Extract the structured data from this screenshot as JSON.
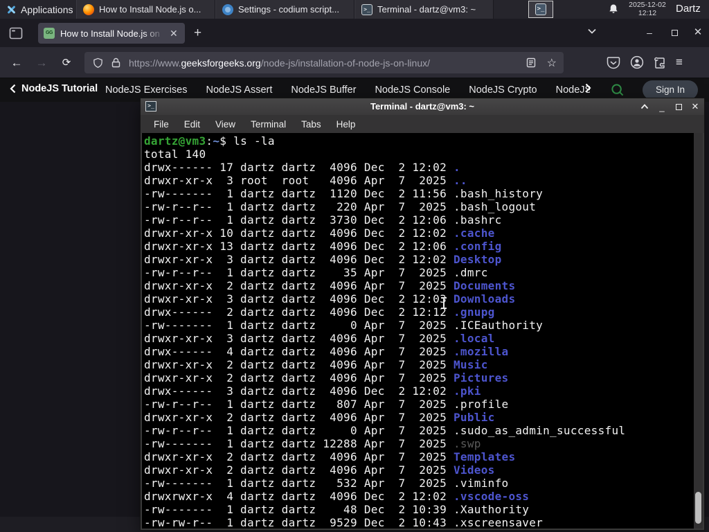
{
  "panel": {
    "applications_label": "Applications",
    "windows": [
      {
        "app": "firefox",
        "title": "How to Install Node.js o..."
      },
      {
        "app": "codium",
        "title": "Settings - codium script..."
      },
      {
        "app": "terminal",
        "title": "Terminal - dartz@vm3: ~"
      }
    ],
    "clock_date": "2025-12-02",
    "clock_time": "12:12",
    "user": "Dartz"
  },
  "browser": {
    "tab_title": "How to Install Node.js on",
    "favicon_text": "GG",
    "new_tab_label": "+",
    "url_scheme": "https://www.",
    "url_domain": "geeksforgeeks.org",
    "url_path": "/node-js/installation-of-node-js-on-linux/",
    "site_nav": {
      "back_label": "NodeJS Tutorial",
      "links": [
        "NodeJS Exercises",
        "NodeJS Assert",
        "NodeJS Buffer",
        "NodeJS Console",
        "NodeJS Crypto",
        "NodeJS DNS",
        "Node"
      ],
      "sign_in_label": "Sign In",
      "accent_green": "#2f8d46"
    }
  },
  "terminal": {
    "window_title": "Terminal - dartz@vm3: ~",
    "menu": [
      "File",
      "Edit",
      "View",
      "Terminal",
      "Tabs",
      "Help"
    ],
    "prompt_user_host": "dartz@vm3",
    "prompt_colon": ":",
    "prompt_path": "~",
    "prompt_symbol": "$",
    "command": " ls -la",
    "total_line": "total 140",
    "colors": {
      "directory_blue": "#4d55cf",
      "prompt_green": "#35a335",
      "dim_gray": "#5a5a5a"
    },
    "rows": [
      {
        "p": "drwx------ 17 dartz dartz  4096 Dec  2 12:02 ",
        "n": ".",
        "t": "d"
      },
      {
        "p": "drwxr-xr-x  3 root  root   4096 Apr  7  2025 ",
        "n": "..",
        "t": "d"
      },
      {
        "p": "-rw-------  1 dartz dartz  1120 Dec  2 11:56 ",
        "n": ".bash_history",
        "t": "f"
      },
      {
        "p": "-rw-r--r--  1 dartz dartz   220 Apr  7  2025 ",
        "n": ".bash_logout",
        "t": "f"
      },
      {
        "p": "-rw-r--r--  1 dartz dartz  3730 Dec  2 12:06 ",
        "n": ".bashrc",
        "t": "f"
      },
      {
        "p": "drwxr-xr-x 10 dartz dartz  4096 Dec  2 12:02 ",
        "n": ".cache",
        "t": "d"
      },
      {
        "p": "drwxr-xr-x 13 dartz dartz  4096 Dec  2 12:06 ",
        "n": ".config",
        "t": "d"
      },
      {
        "p": "drwxr-xr-x  3 dartz dartz  4096 Dec  2 12:02 ",
        "n": "Desktop",
        "t": "d"
      },
      {
        "p": "-rw-r--r--  1 dartz dartz    35 Apr  7  2025 ",
        "n": ".dmrc",
        "t": "f"
      },
      {
        "p": "drwxr-xr-x  2 dartz dartz  4096 Apr  7  2025 ",
        "n": "Documents",
        "t": "d"
      },
      {
        "p": "drwxr-xr-x  3 dartz dartz  4096 Dec  2 12:03 ",
        "n": "Downloads",
        "t": "d"
      },
      {
        "p": "drwx------  2 dartz dartz  4096 Dec  2 12:12 ",
        "n": ".gnupg",
        "t": "d"
      },
      {
        "p": "-rw-------  1 dartz dartz     0 Apr  7  2025 ",
        "n": ".ICEauthority",
        "t": "f"
      },
      {
        "p": "drwxr-xr-x  3 dartz dartz  4096 Apr  7  2025 ",
        "n": ".local",
        "t": "d"
      },
      {
        "p": "drwx------  4 dartz dartz  4096 Apr  7  2025 ",
        "n": ".mozilla",
        "t": "d"
      },
      {
        "p": "drwxr-xr-x  2 dartz dartz  4096 Apr  7  2025 ",
        "n": "Music",
        "t": "d"
      },
      {
        "p": "drwxr-xr-x  2 dartz dartz  4096 Apr  7  2025 ",
        "n": "Pictures",
        "t": "d"
      },
      {
        "p": "drwx------  3 dartz dartz  4096 Dec  2 12:02 ",
        "n": ".pki",
        "t": "d"
      },
      {
        "p": "-rw-r--r--  1 dartz dartz   807 Apr  7  2025 ",
        "n": ".profile",
        "t": "f"
      },
      {
        "p": "drwxr-xr-x  2 dartz dartz  4096 Apr  7  2025 ",
        "n": "Public",
        "t": "d"
      },
      {
        "p": "-rw-r--r--  1 dartz dartz     0 Apr  7  2025 ",
        "n": ".sudo_as_admin_successful",
        "t": "f"
      },
      {
        "p": "-rw-------  1 dartz dartz 12288 Apr  7  2025 ",
        "n": ".swp",
        "t": "dim"
      },
      {
        "p": "drwxr-xr-x  2 dartz dartz  4096 Apr  7  2025 ",
        "n": "Templates",
        "t": "d"
      },
      {
        "p": "drwxr-xr-x  2 dartz dartz  4096 Apr  7  2025 ",
        "n": "Videos",
        "t": "d"
      },
      {
        "p": "-rw-------  1 dartz dartz   532 Apr  7  2025 ",
        "n": ".viminfo",
        "t": "f"
      },
      {
        "p": "drwxrwxr-x  4 dartz dartz  4096 Dec  2 12:02 ",
        "n": ".vscode-oss",
        "t": "d"
      },
      {
        "p": "-rw-------  1 dartz dartz    48 Dec  2 10:39 ",
        "n": ".Xauthority",
        "t": "f"
      },
      {
        "p": "-rw-rw-r--  1 dartz dartz  9529 Dec  2 10:43 ",
        "n": ".xscreensaver",
        "t": "f"
      }
    ]
  }
}
